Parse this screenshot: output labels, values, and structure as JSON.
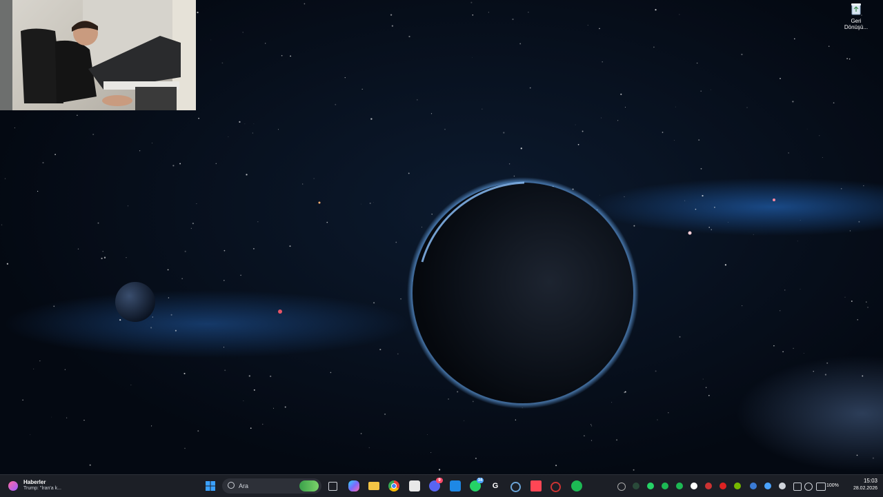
{
  "desktop": {
    "icons": [
      {
        "label": "Geri Dönüşü...",
        "icon": "recycle-bin-icon"
      }
    ]
  },
  "taskbar": {
    "widget": {
      "title": "Haberler",
      "headline": "Trump: \"İran'a k..."
    },
    "search": {
      "placeholder": "Ara"
    },
    "apps": [
      {
        "name": "start",
        "icon": "windows-start-icon",
        "color": "#3aa0ff"
      },
      {
        "name": "task-view",
        "icon": "task-view-icon",
        "color": "#cfd3da"
      },
      {
        "name": "copilot",
        "icon": "copilot-icon",
        "color": "#7a6bff"
      },
      {
        "name": "file-explorer",
        "icon": "folder-icon",
        "color": "#f3c545"
      },
      {
        "name": "chrome",
        "icon": "chrome-icon",
        "color": "#ea4335"
      },
      {
        "name": "store",
        "icon": "store-icon",
        "color": "#e8e8e8"
      },
      {
        "name": "discord",
        "icon": "discord-icon",
        "color": "#5865f2",
        "badge": "9"
      },
      {
        "name": "mail",
        "icon": "mail-icon",
        "color": "#1e88e5"
      },
      {
        "name": "whatsapp",
        "icon": "whatsapp-icon",
        "color": "#25d366",
        "badge": "34"
      },
      {
        "name": "g-app",
        "icon": "g-letter-icon",
        "color": "#ffffff"
      },
      {
        "name": "network-app",
        "icon": "network-icon",
        "color": "#6aa5d8"
      },
      {
        "name": "valorant",
        "icon": "valorant-icon",
        "color": "#ff4655"
      },
      {
        "name": "app-red",
        "icon": "settings-red-icon",
        "color": "#cc3333"
      },
      {
        "name": "spotify",
        "icon": "spotify-icon",
        "color": "#1db954"
      }
    ],
    "tray": {
      "battery": "100%",
      "time": "15:03",
      "date": "28.02.2026"
    }
  }
}
